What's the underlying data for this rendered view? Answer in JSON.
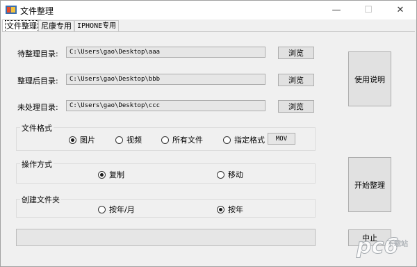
{
  "window": {
    "title": "文件整理",
    "controls": {
      "minimize": "—",
      "maximize": "☐",
      "close": "✕"
    }
  },
  "tabs": [
    {
      "label": "文件整理",
      "active": true
    },
    {
      "label": "尼康专用",
      "active": false
    },
    {
      "label": "IPHONE专用",
      "active": false
    }
  ],
  "dirs": {
    "source": {
      "label": "待整理目录:",
      "value": "C:\\Users\\gao\\Desktop\\aaa",
      "browse": "浏览"
    },
    "target": {
      "label": "整理后目录:",
      "value": "C:\\Users\\gao\\Desktop\\bbb",
      "browse": "浏览"
    },
    "unprocessed": {
      "label": "未处理目录:",
      "value": "C:\\Users\\gao\\Desktop\\ccc",
      "browse": "浏览"
    }
  },
  "buttons": {
    "help": "使用说明",
    "start": "开始整理",
    "stop": "中止"
  },
  "file_format": {
    "title": "文件格式",
    "options": [
      {
        "label": "图片",
        "checked": true
      },
      {
        "label": "视频",
        "checked": false
      },
      {
        "label": "所有文件",
        "checked": false
      },
      {
        "label": "指定格式",
        "checked": false
      }
    ],
    "custom_format": "MOV"
  },
  "operation": {
    "title": "操作方式",
    "options": [
      {
        "label": "复制",
        "checked": true
      },
      {
        "label": "移动",
        "checked": false
      }
    ]
  },
  "create_folder": {
    "title": "创建文件夹",
    "options": [
      {
        "label": "按年/月",
        "checked": false
      },
      {
        "label": "按年",
        "checked": true
      }
    ]
  },
  "progress": {
    "value": 0
  },
  "watermark": {
    "logo": "pc6",
    "text": "下载站"
  }
}
